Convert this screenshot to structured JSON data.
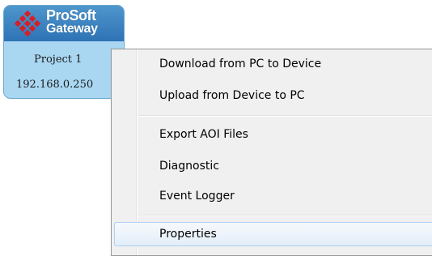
{
  "device_tile": {
    "logo_line1": "ProSoft",
    "logo_line2": "Gateway",
    "project_name": "Project 1",
    "ip_address": "192.168.0.250"
  },
  "context_menu": {
    "items": [
      {
        "label": "Download from PC to Device"
      },
      {
        "label": "Upload from Device to PC"
      },
      {
        "label": "Export AOI Files"
      },
      {
        "label": "Diagnostic"
      },
      {
        "label": "Event Logger"
      },
      {
        "label": "Properties",
        "highlighted": true
      }
    ]
  },
  "colors": {
    "logo_red": "#d42027",
    "tile_header": "#2e73b5",
    "tile_body": "#a9d7f2",
    "menu_background": "#f0f0f0"
  }
}
